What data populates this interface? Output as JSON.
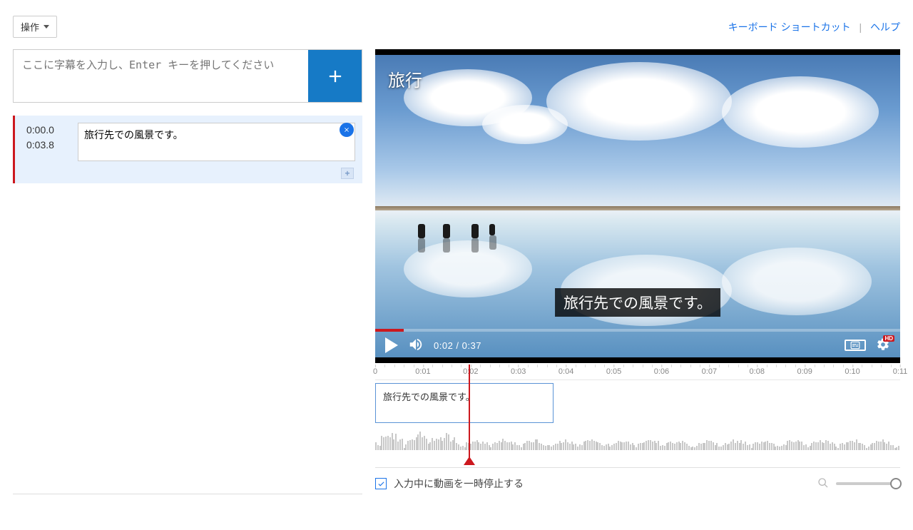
{
  "toolbar": {
    "actions_label": "操作"
  },
  "top_links": {
    "shortcuts": "キーボード ショートカット",
    "help": "ヘルプ"
  },
  "input": {
    "placeholder": "ここに字幕を入力し、Enter キーを押してください"
  },
  "subtitles": [
    {
      "start": "0:00.0",
      "end": "0:03.8",
      "text": "旅行先での風景です。"
    }
  ],
  "video": {
    "title": "旅行",
    "caption_overlay": "旅行先での風景です。",
    "current_time": "0:02",
    "duration": "0:37",
    "time_display": "0:02 / 0:37",
    "quality_badge": "HD",
    "cc_label": "CC"
  },
  "timeline": {
    "ticks": [
      "0",
      "0:01",
      "0:02",
      "0:03",
      "0:04",
      "0:05",
      "0:06",
      "0:07",
      "0:08",
      "0:09",
      "0:10",
      "0:11"
    ],
    "clip_text": "旅行先での風景です。",
    "playhead_position_pct": 17.8
  },
  "footer": {
    "pause_while_typing": "入力中に動画を一時停止する",
    "pause_checked": true
  }
}
